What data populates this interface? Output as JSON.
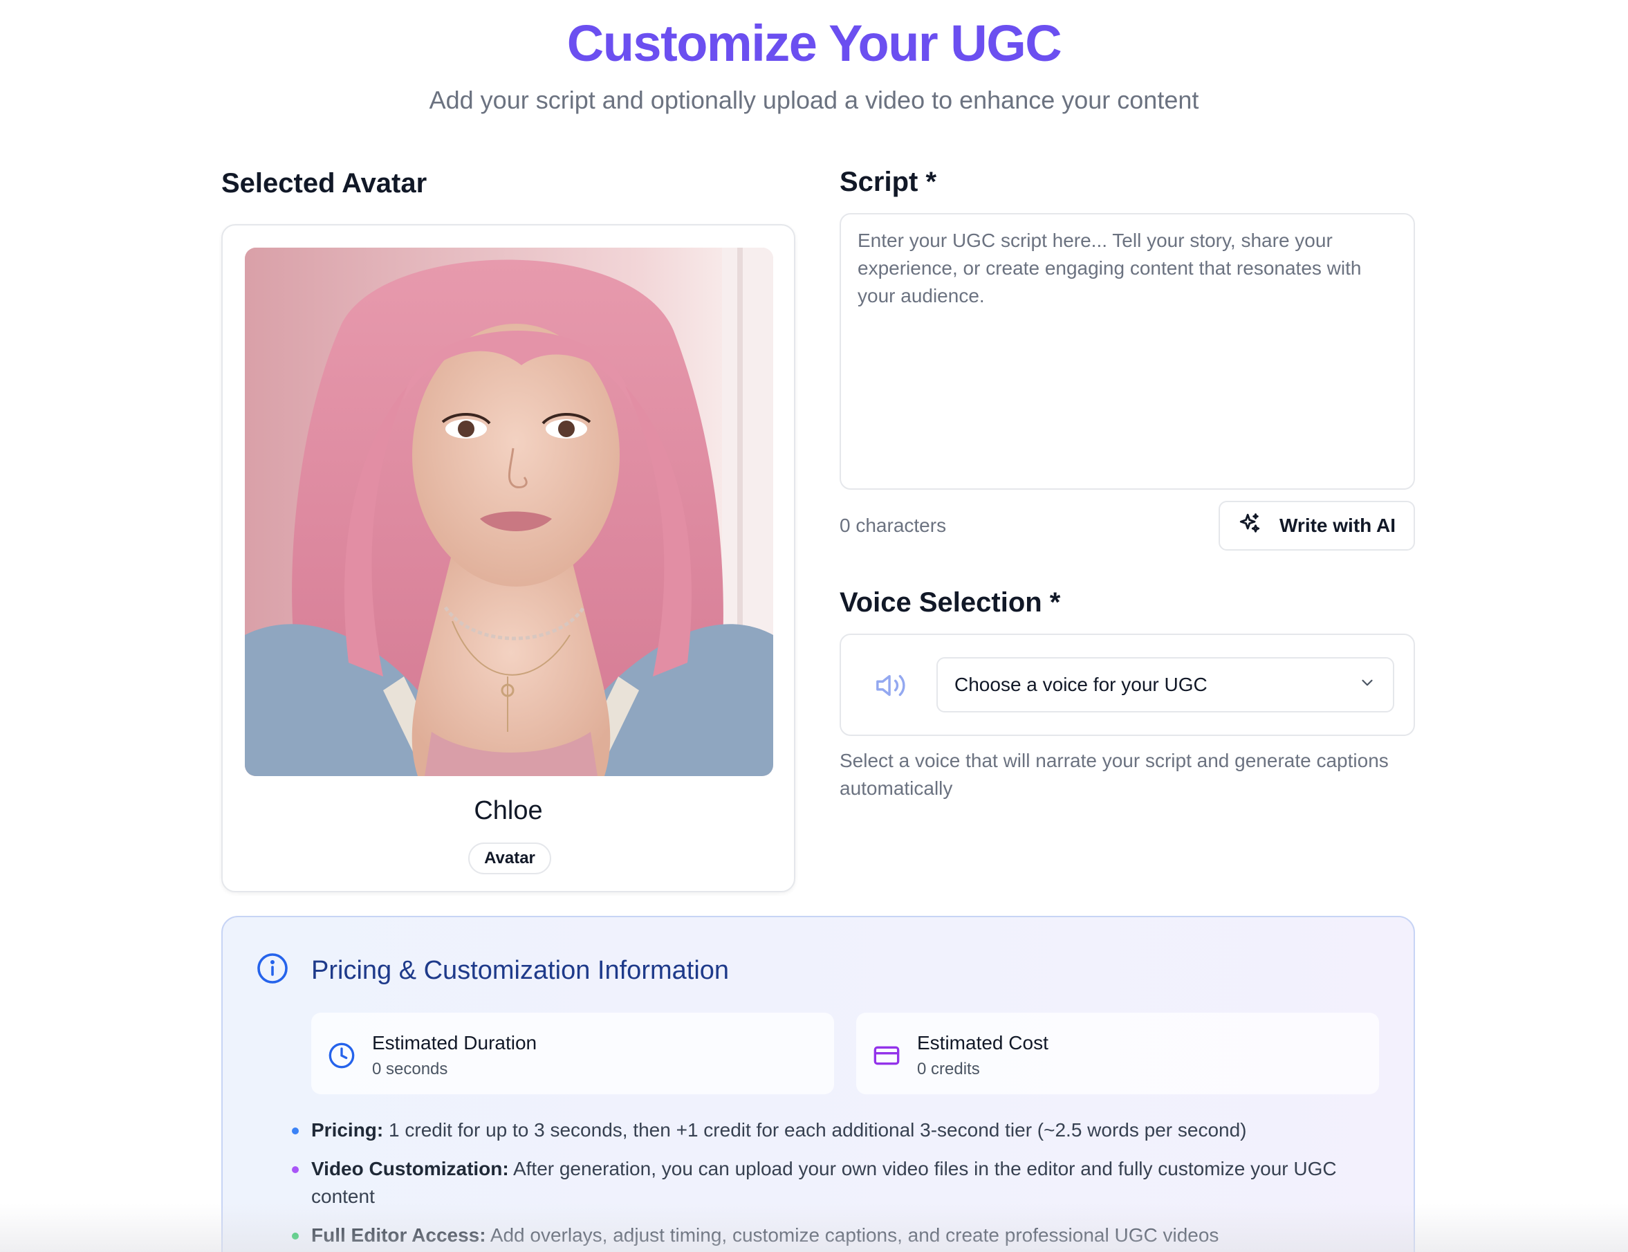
{
  "header": {
    "title": "Customize Your UGC",
    "subtitle": "Add your script and optionally upload a video to enhance your content"
  },
  "avatar_section": {
    "heading": "Selected Avatar",
    "name": "Chloe",
    "badge": "Avatar"
  },
  "script_section": {
    "heading": "Script *",
    "placeholder": "Enter your UGC script here... Tell your story, share your experience, or create engaging content that resonates with your audience.",
    "value": "",
    "char_count": "0 characters",
    "ai_button_label": "Write with AI"
  },
  "voice_section": {
    "heading": "Voice Selection *",
    "select_value": "Choose a voice for your UGC",
    "help_text": "Select a voice that will narrate your script and generate captions automatically"
  },
  "pricing": {
    "title": "Pricing & Customization Information",
    "duration_label": "Estimated Duration",
    "duration_value": "0 seconds",
    "cost_label": "Estimated Cost",
    "cost_value": "0 credits",
    "bullets": [
      {
        "label": "Pricing:",
        "text": " 1 credit for up to 3 seconds, then +1 credit for each additional 3-second tier (~2.5 words per second)",
        "color": "#3b82f6"
      },
      {
        "label": "Video Customization:",
        "text": " After generation, you can upload your own video files in the editor and fully customize your UGC content",
        "color": "#a855f7"
      },
      {
        "label": "Full Editor Access:",
        "text": " Add overlays, adjust timing, customize captions, and create professional UGC videos",
        "color": "#22c55e"
      }
    ]
  },
  "colors": {
    "title_accent": "#6b4ff0",
    "pricing_title": "#1e3a8a",
    "info_icon": "#2563eb",
    "clock_icon": "#2563eb",
    "card_icon": "#9333ea",
    "speaker_icon": "#93a8f0"
  },
  "icons": {
    "ai_button": "sparkles-icon",
    "voice": "speaker-icon",
    "select": "chevron-down-icon",
    "pricing": "info-icon",
    "duration": "clock-icon",
    "cost": "credit-card-icon"
  }
}
